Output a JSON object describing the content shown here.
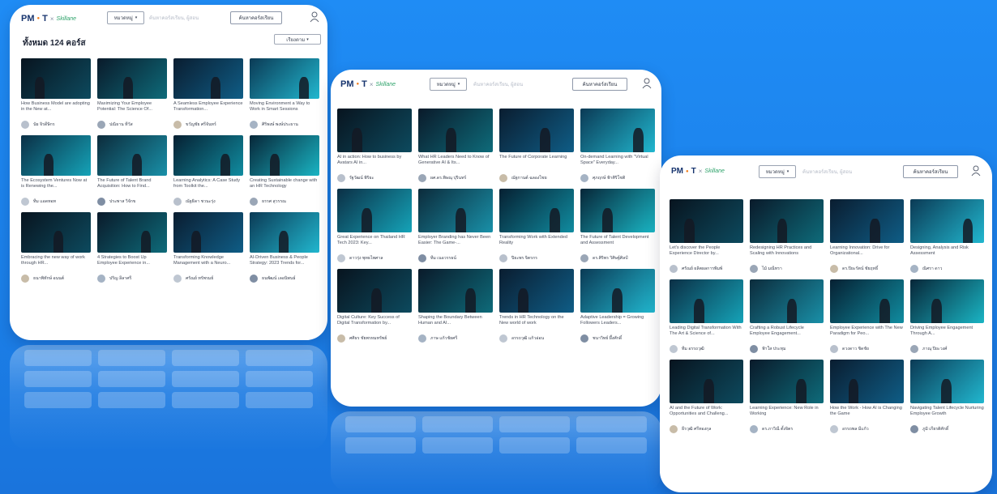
{
  "colors": {
    "accent": "#1f8cf5",
    "logo_blue": "#17346e",
    "logo_orange": "#f07c1a",
    "logo_green": "#2fa36b"
  },
  "header": {
    "logo_pm": "PM",
    "logo_dot": "●",
    "logo_t": "T",
    "logo_sep": "×",
    "logo_skill": "Skillane",
    "category_label": "หมวดหมู่",
    "search_placeholder": "ค้นหาคอร์สเรียน, ผู้สอน",
    "search_button": "ค้นหาคอร์สเรียน",
    "user_icon": "user-icon"
  },
  "panel1": {
    "count": "ทั้งหมด 124 คอร์ส",
    "sort_label": "เรียงตาม",
    "cards": [
      {
        "title": "How Business Model are adopting in the New at...",
        "author": "นัย จิรดีษิกร"
      },
      {
        "title": "Maximizing Your Employee Potential: The Science Of...",
        "author": "ปณิธาน ทีวัส"
      },
      {
        "title": "A Seamless Employee Experience Transformation...",
        "author": "ขวัญชัย ศรีจันทร์"
      },
      {
        "title": "Moving Environment a Way to Work in Smart Sessions",
        "author": "ศิริพงษ์ พงษ์ประธาน"
      },
      {
        "title": "The Ecosystem Ventures Now at is Renewing the...",
        "author": "ทีม แอดทอท"
      },
      {
        "title": "The Future of Talent Brand Acquisition: How to Find...",
        "author": "ประพาส วิจักข"
      },
      {
        "title": "Learning Analytics: A Case Study from Toolkit the...",
        "author": "ณัฐธิดา ชวนะรุ่ง"
      },
      {
        "title": "Creating Sustainable change with an HR Technology",
        "author": "ธรรศ สุวรรณ"
      },
      {
        "title": "Embracing the new way of work through HR...",
        "author": "ธนาพิทักษ์ อนนต์"
      },
      {
        "title": "4 Strategies to Boost Up Employee Experience in...",
        "author": "ปริญ ลีลาศรี"
      },
      {
        "title": "Transforming Knowledge Management with a Neuro...",
        "author": "ศรัณย์ ทรัพรมย์"
      },
      {
        "title": "AI-Driven Business & People Strategy: 2023 Trends for...",
        "author": "ธนพัฒน์ เลอนิพนธ์"
      }
    ]
  },
  "panel2": {
    "cards": [
      {
        "title": "AI in action: How to business by Avatars AI in...",
        "author": "รัฐวัฒน์ พิริยะ"
      },
      {
        "title": "What HR Leaders Need to Know of Generative AI & Its...",
        "author": "ผศ.ดร.พิษณุ ปุรินทร์"
      },
      {
        "title": "The Future of Corporate Learning",
        "author": "ณัฐกานต์ ฉลองไชย"
      },
      {
        "title": "On-demand Learning with \"Virtual Space\" Everyday...",
        "author": "ศุภฤกษ์ ฟ้าศิริโชติ"
      },
      {
        "title": "Great Experience on Thailand HR Tech 2023: Key...",
        "author": "ดาวรุ่ง พุทธไพศาล"
      },
      {
        "title": "Employer Branding has Never Been Easier: The Game-...",
        "author": "ทีม เนอวรรธน์"
      },
      {
        "title": "Transforming Work with Extended Reality",
        "author": "ปิยะพร จิตรกร"
      },
      {
        "title": "The Future of Talent Development and Assessment",
        "author": "ดร.ศิริพร วิศิษฐ์ศิลป์"
      },
      {
        "title": "Digital Culture: Key Success of Digital Transformation by...",
        "author": "ศศิธร ชัยพรหมทรัพย์"
      },
      {
        "title": "Shaping the Boundary Between Human and AI...",
        "author": "ภาษ แก้วชัยศรี"
      },
      {
        "title": "Trends in HR Technology on the New world of work",
        "author": "อรรถวุฒิ แก้วอ่อน"
      },
      {
        "title": "Adaptive Leadership = Growing Followers Leaders...",
        "author": "ชนาวิทย์ ผึ้งศักดิ์"
      }
    ]
  },
  "panel3": {
    "cards": [
      {
        "title": "Let's discover the People Experience Director by...",
        "author": "ศรัณย์ ผลิตผลการพิมพ์"
      },
      {
        "title": "Redesigning HR Practices and Scaling with Innovations",
        "author": "ไม้ มณีทรา"
      },
      {
        "title": "Learning Innovation: Drive for Organizational...",
        "author": "ดร.ปิยะรัตน์ ชัยฤทธิ์"
      },
      {
        "title": "Designing, Analysis and Risk Assessment",
        "author": "ณิศรา ดาว"
      },
      {
        "title": "Leading Digital Transformation With The Art & Science of...",
        "author": "ทีม อรรถวุฒิ"
      },
      {
        "title": "Crafting a Robust Lifecycle Employee Engagement...",
        "author": "ฟ้าใส ประทุม"
      },
      {
        "title": "Employee Experience with The New Paradigm for Peo...",
        "author": "ดวงดาว ชิดชัย"
      },
      {
        "title": "Driving Employee Engagement Through A...",
        "author": "ภาณุ ปิยะวงศ์"
      },
      {
        "title": "AI and the Future of Work: Opportunities and Challeng...",
        "author": "ธีรวุฒิ ศรีทองกุล"
      },
      {
        "title": "Learning Experience: New Role in Working",
        "author": "ดร.ภาวิณี ตั้งจิตร"
      },
      {
        "title": "How the Work - How AI is Changing the Game",
        "author": "อรรถพล มีแก้ว"
      },
      {
        "title": "Navigating Talent Lifecycle Nurturing Employee Growth",
        "author": "ภูมิ เกียรติศักดิ์"
      }
    ]
  }
}
